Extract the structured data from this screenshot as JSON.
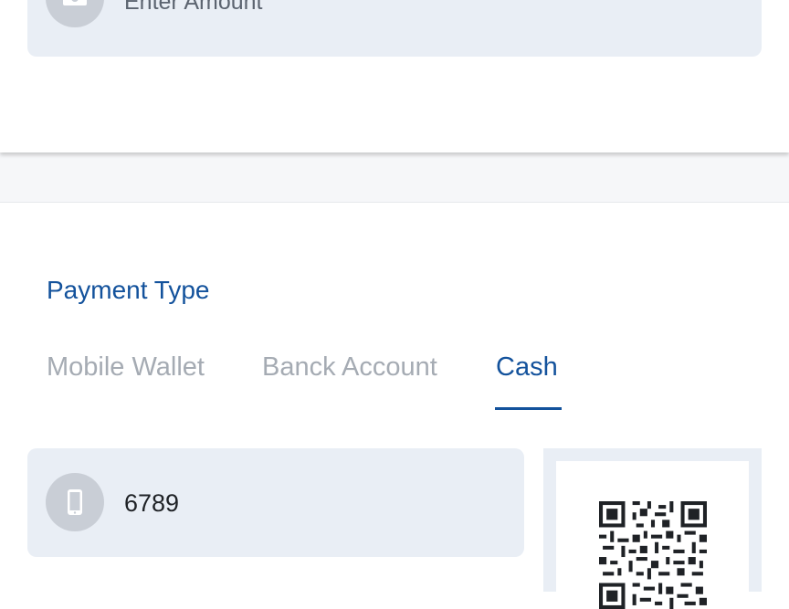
{
  "amount": {
    "placeholder": "Enter Amount",
    "icon": "cash-icon"
  },
  "payment": {
    "section_title": "Payment Type",
    "tabs": [
      {
        "label": "Mobile Wallet",
        "active": false
      },
      {
        "label": "Banck Account",
        "active": false
      },
      {
        "label": "Cash",
        "active": true
      }
    ],
    "phone": {
      "value": "6789",
      "icon": "phone-icon"
    },
    "qr_icon": "qr-code-icon"
  },
  "colors": {
    "accent": "#13529c",
    "field_bg": "#e9eef5",
    "icon_circle": "#c9ced6",
    "inactive_tab": "#a5abb3"
  }
}
